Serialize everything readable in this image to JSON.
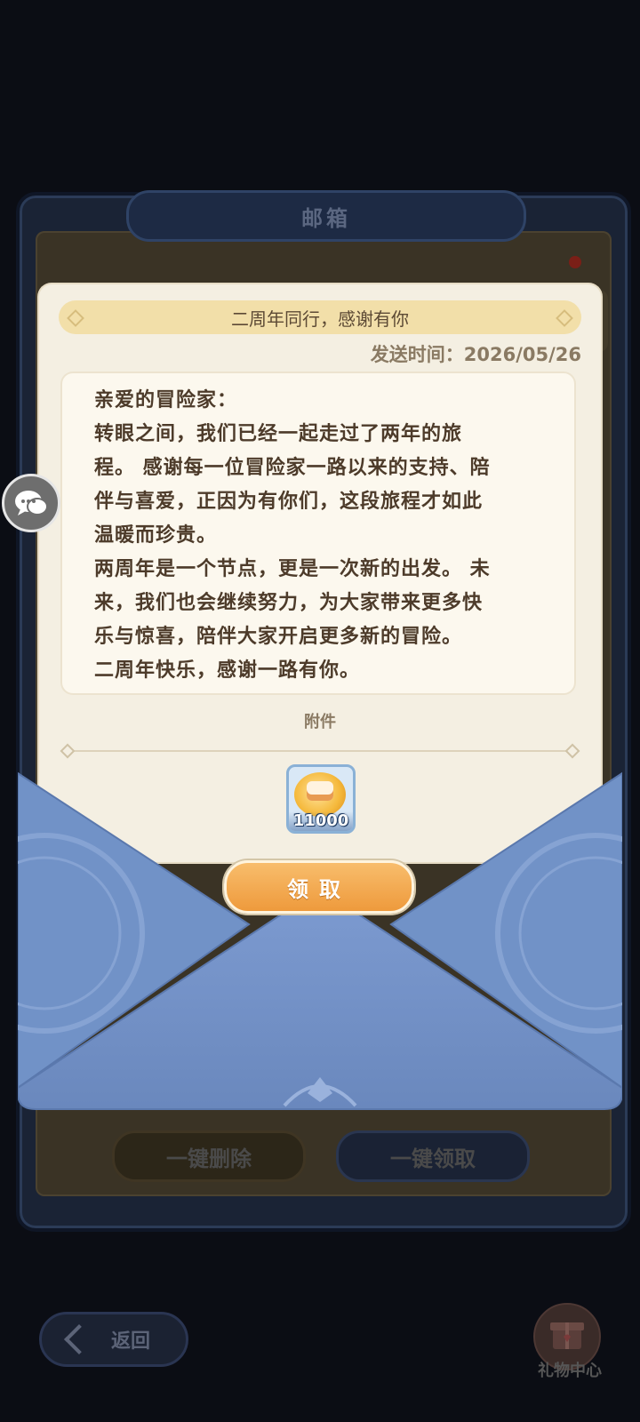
{
  "mailbox": {
    "title": "邮箱",
    "delete_all_label": "一键删除",
    "claim_all_label": "一键领取"
  },
  "letter": {
    "subject": "二周年同行，感谢有你",
    "send_time": "发送时间：2026/05/26",
    "body_lines": [
      "亲爱的冒险家：",
      "转眼之间，我们已经一起走过了两年的旅",
      "程。 感谢每一位冒险家一路以来的支持、陪",
      "伴与喜爱，正因为有你们，这段旅程才如此",
      "温暖而珍贵。",
      "两周年是一个节点，更是一次新的出发。 未",
      "来，我们也会继续努力，为大家带来更多快",
      "乐与惊喜，陪伴大家开启更多新的冒险。",
      "二周年快乐，感谢一路有你。"
    ],
    "attachment_label": "附件",
    "attachment_item": {
      "icon": "coin-cake-icon",
      "count": "11000"
    },
    "claim_label": "领取"
  },
  "nav": {
    "back_label": "返回",
    "gift_center_label": "礼物中心"
  },
  "colors": {
    "envelope": "#7392c6",
    "claim_button": "#f2a64a",
    "letter_bg": "#f4efe2"
  }
}
